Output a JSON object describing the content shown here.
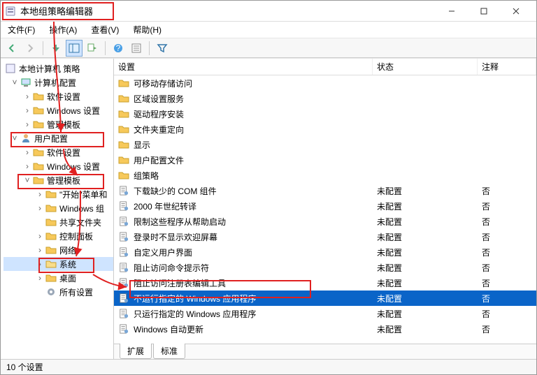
{
  "window": {
    "title": "本地组策略编辑器"
  },
  "menu": {
    "file": "文件(F)",
    "action": "操作(A)",
    "view": "查看(V)",
    "help": "帮助(H)"
  },
  "tree": {
    "root": "本地计算机 策略",
    "computer_config": "计算机配置",
    "cc_software": "软件设置",
    "cc_windows": "Windows 设置",
    "cc_admin": "管理模板",
    "user_config": "用户配置",
    "uc_software": "软件设置",
    "uc_windows": "Windows 设置",
    "uc_admin": "管理模板",
    "start_menu": "\"开始\"菜单和",
    "windows_group": "Windows 组",
    "shared_folders": "共享文件夹",
    "control_panel": "控制面板",
    "network": "网络",
    "system": "系统",
    "desktop": "桌面",
    "all_settings": "所有设置"
  },
  "columns": {
    "name": "设置",
    "state": "状态",
    "note": "注释"
  },
  "tabs": {
    "extended": "扩展",
    "standard": "标准"
  },
  "status": "10 个设置",
  "state_unconfigured": "未配置",
  "note_no": "否",
  "list": [
    {
      "type": "folder",
      "name": "可移动存储访问"
    },
    {
      "type": "folder",
      "name": "区域设置服务"
    },
    {
      "type": "folder",
      "name": "驱动程序安装"
    },
    {
      "type": "folder",
      "name": "文件夹重定向"
    },
    {
      "type": "folder",
      "name": "显示"
    },
    {
      "type": "folder",
      "name": "用户配置文件"
    },
    {
      "type": "folder",
      "name": "组策略"
    },
    {
      "type": "setting",
      "name": "下载缺少的 COM 组件",
      "state": "未配置",
      "note": "否"
    },
    {
      "type": "setting",
      "name": "2000 年世纪转译",
      "state": "未配置",
      "note": "否"
    },
    {
      "type": "setting",
      "name": "限制这些程序从帮助启动",
      "state": "未配置",
      "note": "否"
    },
    {
      "type": "setting",
      "name": "登录时不显示欢迎屏幕",
      "state": "未配置",
      "note": "否"
    },
    {
      "type": "setting",
      "name": "自定义用户界面",
      "state": "未配置",
      "note": "否"
    },
    {
      "type": "setting",
      "name": "阻止访问命令提示符",
      "state": "未配置",
      "note": "否"
    },
    {
      "type": "setting",
      "name": "阻止访问注册表编辑工具",
      "state": "未配置",
      "note": "否"
    },
    {
      "type": "setting",
      "name": "不运行指定的 Windows 应用程序",
      "state": "未配置",
      "note": "否",
      "selected": true
    },
    {
      "type": "setting",
      "name": "只运行指定的 Windows 应用程序",
      "state": "未配置",
      "note": "否"
    },
    {
      "type": "setting",
      "name": "Windows 自动更新",
      "state": "未配置",
      "note": "否"
    }
  ],
  "annotations": {
    "note": "red boxes and arrows are tutorial overlays highlighting: title bar, 用户配置, 管理模板, 系统, and the selected list row"
  }
}
